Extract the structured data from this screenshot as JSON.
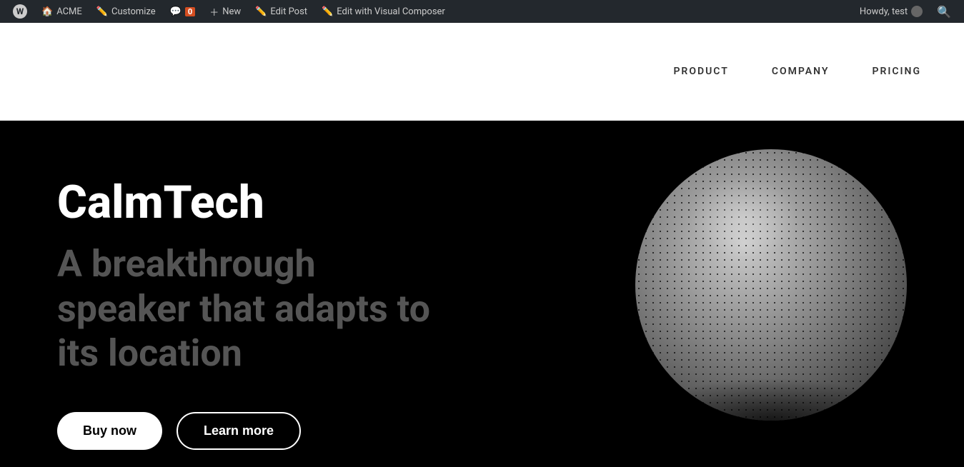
{
  "adminBar": {
    "wpIcon": "W",
    "items": [
      {
        "id": "wp-logo",
        "label": "",
        "icon": "wordpress-icon"
      },
      {
        "id": "acme",
        "label": "ACME",
        "icon": "home-icon"
      },
      {
        "id": "customize",
        "label": "Customize",
        "icon": "edit-icon"
      },
      {
        "id": "comments",
        "label": "0",
        "icon": "comment-icon"
      },
      {
        "id": "new",
        "label": "New",
        "icon": "plus-icon"
      },
      {
        "id": "edit-post",
        "label": "Edit Post",
        "icon": "edit-icon"
      },
      {
        "id": "visual-composer",
        "label": "Edit with Visual Composer",
        "icon": null
      }
    ],
    "rightItems": [
      {
        "id": "howdy",
        "label": "Howdy, test",
        "icon": "avatar-icon"
      },
      {
        "id": "search",
        "label": "",
        "icon": "search-icon"
      }
    ]
  },
  "nav": {
    "items": [
      {
        "id": "product",
        "label": "PRODUCT"
      },
      {
        "id": "company",
        "label": "COMPANY"
      },
      {
        "id": "pricing",
        "label": "PRICING"
      }
    ]
  },
  "hero": {
    "title": "CalmTech",
    "subtitle": "A breakthrough speaker that adapts to its location",
    "buyLabel": "Buy now",
    "learnLabel": "Learn more"
  }
}
